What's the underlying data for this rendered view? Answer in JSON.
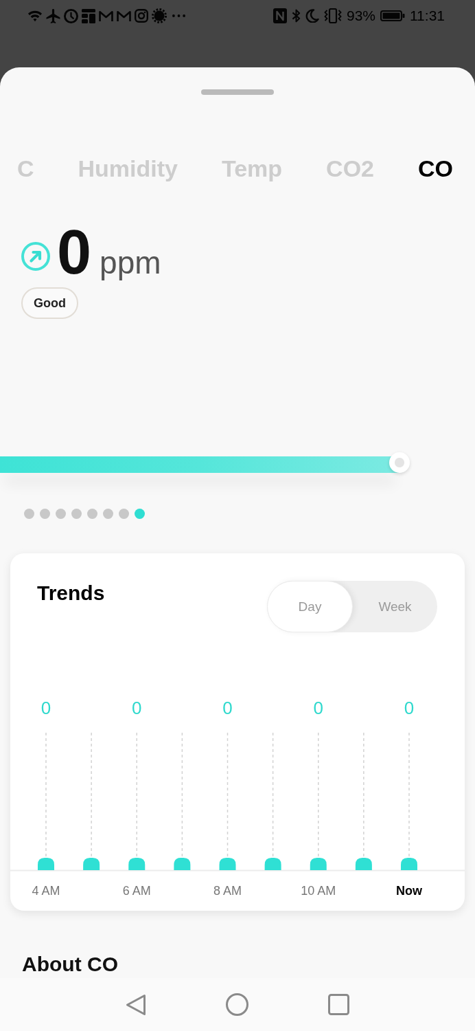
{
  "status_bar": {
    "battery": "93%",
    "time": "11:31"
  },
  "sheet": {
    "tabs": [
      {
        "label": "C",
        "selected": false
      },
      {
        "label": "Humidity",
        "selected": false
      },
      {
        "label": "Temp",
        "selected": false
      },
      {
        "label": "CO2",
        "selected": false
      },
      {
        "label": "CO",
        "selected": true
      }
    ],
    "reading": {
      "value": "0",
      "unit": "ppm",
      "status": "Good"
    },
    "gauge": {
      "level": 0.975
    },
    "pager": [
      {
        "selected": false
      },
      {
        "selected": false
      },
      {
        "selected": false
      },
      {
        "selected": false
      },
      {
        "selected": false
      },
      {
        "selected": false
      },
      {
        "selected": false
      },
      {
        "selected": true
      }
    ],
    "trends": {
      "title": "Trends",
      "range_options": [
        {
          "label": "Day",
          "selected": true
        },
        {
          "label": "Week",
          "selected": false
        }
      ],
      "columns": [
        {
          "value_label": "0",
          "time_label": "4 AM"
        },
        {
          "value_label": "0",
          "time_label": "6 AM"
        },
        {
          "value_label": "0",
          "time_label": "8 AM"
        },
        {
          "value_label": "0",
          "time_label": "10 AM"
        },
        {
          "value_label": "0",
          "time_label": "Now"
        }
      ]
    },
    "about": {
      "title": "About CO"
    }
  }
}
